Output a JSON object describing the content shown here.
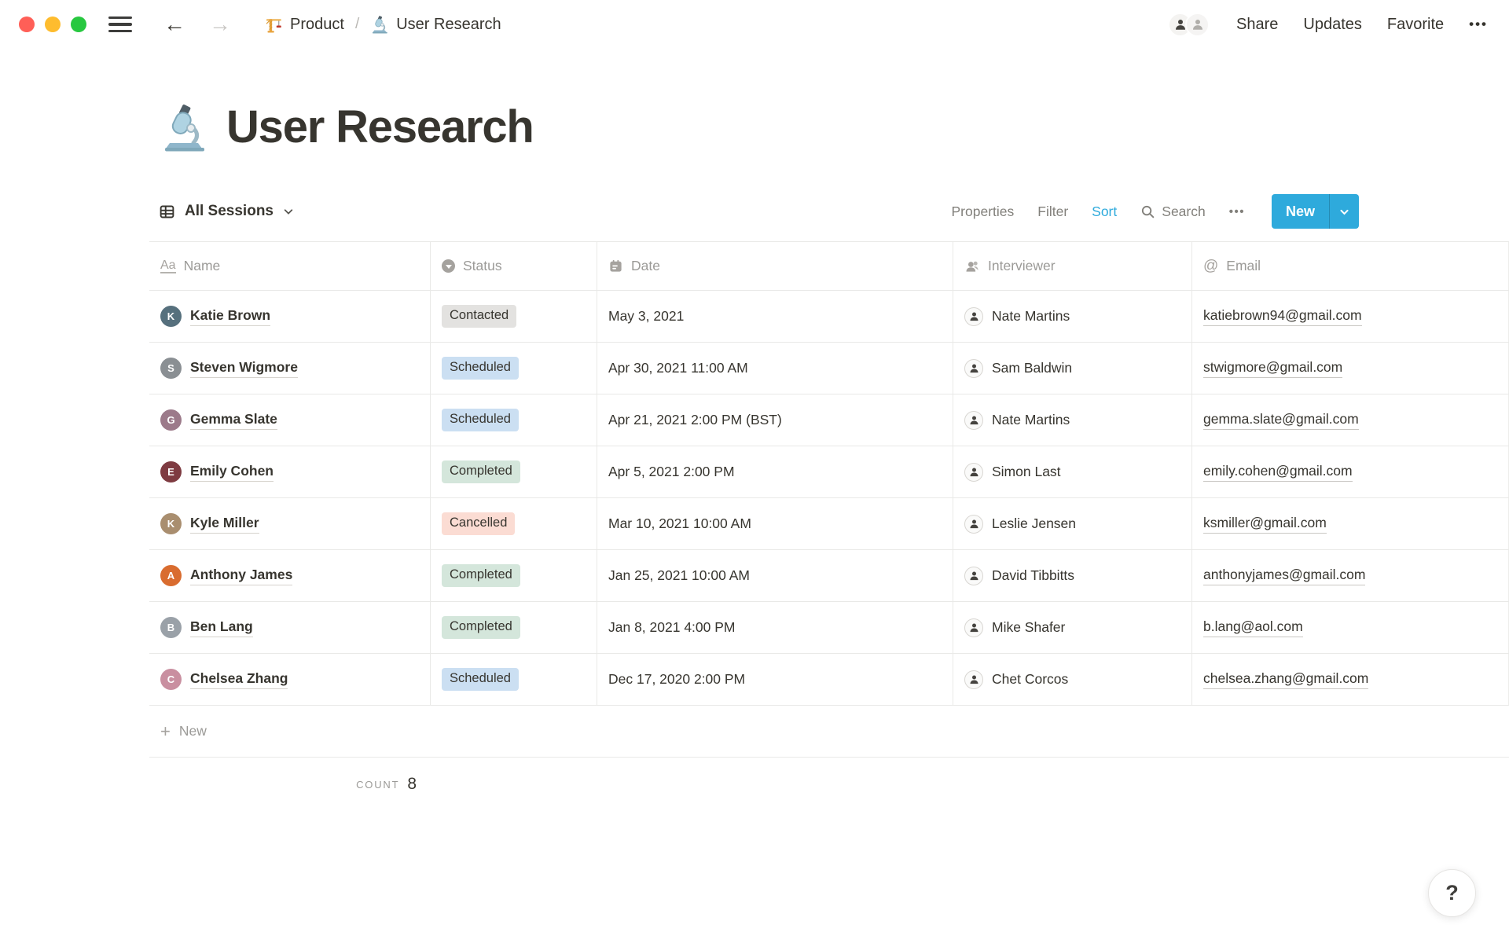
{
  "topbar": {
    "breadcrumb": {
      "workspace": "Product",
      "separator": "/",
      "page": "User Research"
    },
    "share": "Share",
    "updates": "Updates",
    "favorite": "Favorite",
    "more": "•••"
  },
  "page": {
    "title": "User Research"
  },
  "toolbar": {
    "view_name": "All Sessions",
    "properties": "Properties",
    "filter": "Filter",
    "sort": "Sort",
    "search": "Search",
    "more": "•••",
    "new_label": "New",
    "accent_color": "#2EAADC"
  },
  "table": {
    "columns": [
      {
        "label": "Name",
        "icon": "text-icon",
        "icon_glyph": "Aa"
      },
      {
        "label": "Status",
        "icon": "select-icon"
      },
      {
        "label": "Date",
        "icon": "calendar-icon"
      },
      {
        "label": "Interviewer",
        "icon": "person-icon"
      },
      {
        "label": "Email",
        "icon": "email-icon",
        "icon_glyph": "@"
      }
    ],
    "rows": [
      {
        "name": "Katie Brown",
        "initial": "K",
        "avatar_color": "#56707D",
        "status": "Contacted",
        "status_variant": "gray",
        "date": "May 3, 2021",
        "interviewer": "Nate Martins",
        "email": "katiebrown94@gmail.com"
      },
      {
        "name": "Steven Wigmore",
        "initial": "S",
        "avatar_color": "#8A8F93",
        "status": "Scheduled",
        "status_variant": "blue",
        "date": "Apr 30, 2021 11:00 AM",
        "interviewer": "Sam Baldwin",
        "email": "stwigmore@gmail.com"
      },
      {
        "name": "Gemma Slate",
        "initial": "G",
        "avatar_color": "#9C7A8A",
        "status": "Scheduled",
        "status_variant": "blue",
        "date": "Apr 21, 2021 2:00 PM (BST)",
        "interviewer": "Nate Martins",
        "email": "gemma.slate@gmail.com"
      },
      {
        "name": "Emily Cohen",
        "initial": "E",
        "avatar_color": "#7E3B41",
        "status": "Completed",
        "status_variant": "green",
        "date": "Apr 5, 2021 2:00 PM",
        "interviewer": "Simon Last",
        "email": "emily.cohen@gmail.com"
      },
      {
        "name": "Kyle Miller",
        "initial": "K",
        "avatar_color": "#A98E6F",
        "status": "Cancelled",
        "status_variant": "red",
        "date": "Mar 10, 2021 10:00 AM",
        "interviewer": "Leslie Jensen",
        "email": "ksmiller@gmail.com"
      },
      {
        "name": "Anthony James",
        "initial": "A",
        "avatar_color": "#D96C2F",
        "status": "Completed",
        "status_variant": "green",
        "date": "Jan 25, 2021 10:00 AM",
        "interviewer": "David Tibbitts",
        "email": "anthonyjames@gmail.com"
      },
      {
        "name": "Ben Lang",
        "initial": "B",
        "avatar_color": "#9AA1A8",
        "status": "Completed",
        "status_variant": "green",
        "date": "Jan 8, 2021 4:00 PM",
        "interviewer": "Mike Shafer",
        "email": "b.lang@aol.com"
      },
      {
        "name": "Chelsea Zhang",
        "initial": "C",
        "avatar_color": "#C98FA0",
        "status": "Scheduled",
        "status_variant": "blue",
        "date": "Dec 17, 2020 2:00 PM",
        "interviewer": "Chet Corcos",
        "email": "chelsea.zhang@gmail.com"
      }
    ],
    "new_row_label": "New",
    "footer": {
      "count_label": "COUNT",
      "count_value": "8"
    }
  },
  "status_colors": {
    "gray": "#E3E2E0",
    "blue": "#CBDFF2",
    "green": "#D4E6DB",
    "red": "#FBDCD3"
  },
  "icons": {
    "breadcrumb_workspace": "crane-icon",
    "breadcrumb_page": "microscope-icon",
    "page_title": "microscope-icon",
    "view": "table-grid-icon"
  },
  "help": {
    "label": "?"
  }
}
